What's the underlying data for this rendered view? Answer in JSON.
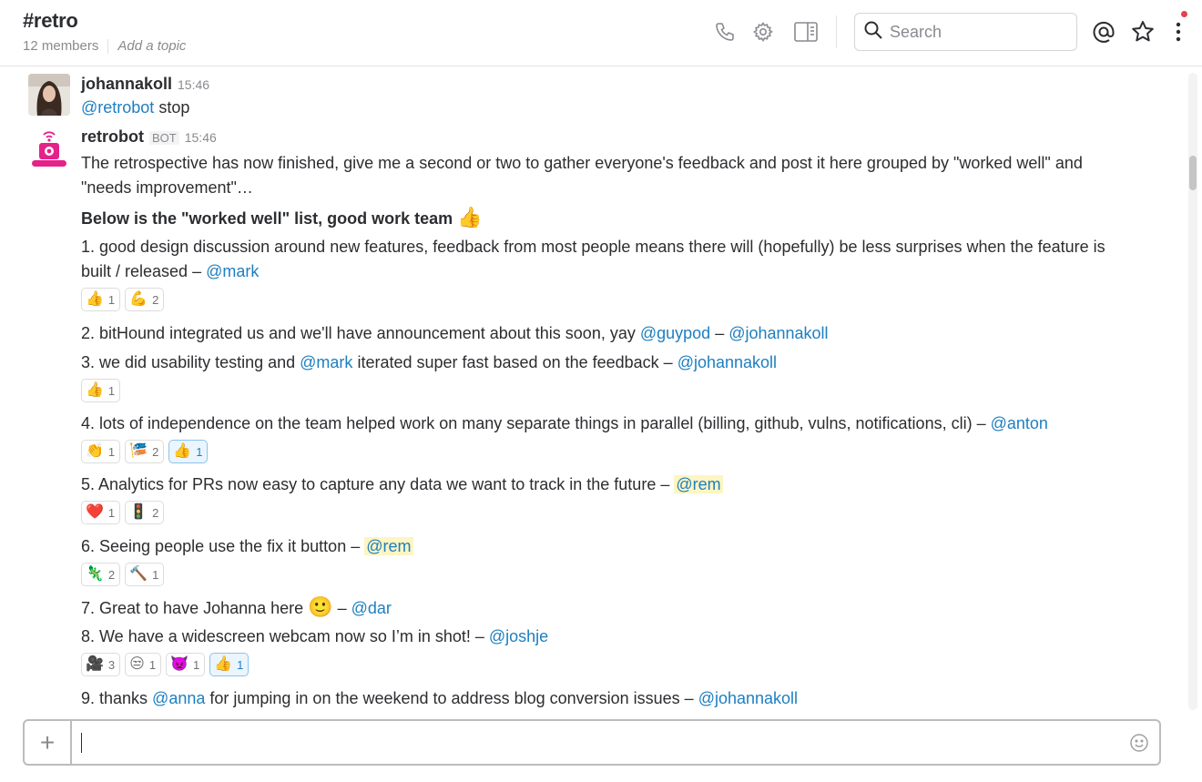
{
  "header": {
    "channel_name": "#retro",
    "members": "12 members",
    "topic_placeholder": "Add a topic",
    "search_placeholder": "Search"
  },
  "messages": [
    {
      "author": "johannakoll",
      "time": "15:46",
      "text_mention": "@retrobot",
      "text": "stop"
    },
    {
      "author": "retrobot",
      "badge": "BOT",
      "time": "15:46",
      "intro_line1": "The retrospective has now finished, give me a second or two to gather everyone's feedback and post it here grouped by \"worked well\" and",
      "intro_line2": "\"needs improvement\"…",
      "heading": "Below is the \"worked well\" list, good work team"
    }
  ],
  "items": [
    {
      "line1": "1. good design discussion around new features, feedback from most people means there will (hopefully) be less surprises when the feature is",
      "line2": "built / released – ",
      "mention": "@mark",
      "reactions": [
        {
          "emoji": "👍",
          "count": "1"
        },
        {
          "emoji": "💪",
          "count": "2"
        }
      ]
    },
    {
      "text": "2. bitHound integrated us and we'll have announcement about this soon, yay ",
      "mention1": "@guypod",
      "sep": " – ",
      "mention2": "@johannakoll"
    },
    {
      "text_a": "3. we did usability testing and ",
      "mention1": "@mark",
      "text_b": " iterated super fast based on the feedback – ",
      "mention2": "@johannakoll",
      "reactions": [
        {
          "emoji": "👍",
          "count": "1"
        }
      ]
    },
    {
      "text": "4. lots of independence on the team helped work on many separate things in parallel (billing, github, vulns, notifications, cli) – ",
      "mention": "@anton",
      "reactions": [
        {
          "emoji": "👏",
          "count": "1"
        },
        {
          "emoji": "🎏",
          "count": "2"
        },
        {
          "emoji": "👍",
          "count": "1"
        }
      ]
    },
    {
      "text": "5. Analytics for PRs now easy to capture any data we want to track in the future – ",
      "mention": "@rem",
      "reactions": [
        {
          "emoji": "❤️",
          "count": "1"
        },
        {
          "emoji": "🚦",
          "count": "2"
        }
      ]
    },
    {
      "text": "6. Seeing people use the fix it button – ",
      "mention": "@rem",
      "reactions": [
        {
          "emoji": "🦎",
          "count": "2"
        },
        {
          "emoji": "🔨",
          "count": "1"
        }
      ]
    },
    {
      "text": "7. Great to have Johanna here ",
      "emoji": "🙂",
      "sep": " – ",
      "mention": "@dar"
    },
    {
      "text": "8. We have a widescreen webcam now so I’m in shot! – ",
      "mention": "@joshje",
      "reactions": [
        {
          "emoji": "🎥",
          "count": "3"
        },
        {
          "emoji": "😒",
          "count": "1"
        },
        {
          "emoji": "👿",
          "count": "1"
        },
        {
          "emoji": "👍",
          "count": "1"
        }
      ]
    },
    {
      "text_a": "9. thanks ",
      "mention1": "@anna",
      "text_b": " for jumping in on the weekend to address blog conversion issues – ",
      "mention2": "@johannakoll"
    }
  ],
  "composer": {
    "plus": "+"
  },
  "colors": {
    "mention": "#1d7fc1",
    "mention_highlight": "#fdf5c2",
    "retrobot_pink": "#e5218a",
    "notification_dot": "#e8404c"
  },
  "icons": [
    "phone-icon",
    "gear-icon",
    "sidebar-toggle-icon",
    "search-icon",
    "at-sign-icon",
    "star-icon",
    "more-vertical-icon",
    "smiley-icon"
  ]
}
